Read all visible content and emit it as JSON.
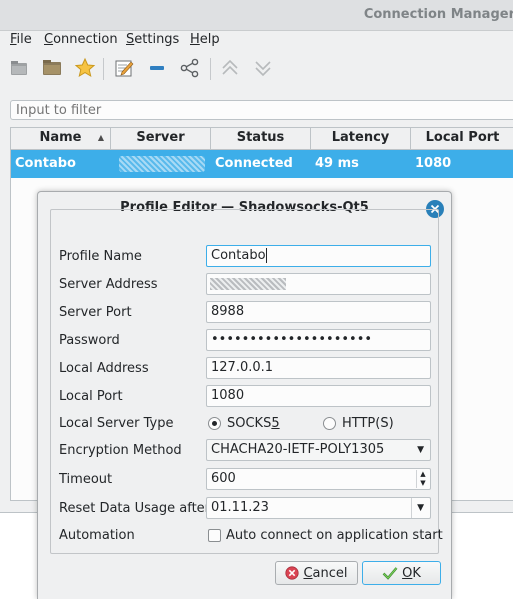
{
  "window": {
    "title": "Connection Manager"
  },
  "menu": {
    "file": {
      "lead": "F",
      "rest": "ile"
    },
    "connection": {
      "lead": "C",
      "rest": "onnection"
    },
    "settings": {
      "lead": "S",
      "rest": "ettings"
    },
    "help": {
      "lead": "H",
      "rest": "elp"
    }
  },
  "toolbar": {
    "icons": [
      "disconnect-icon",
      "folder-icon",
      "star-icon",
      "edit-icon",
      "remove-icon",
      "share-icon",
      "move-up-icon",
      "move-down-icon"
    ]
  },
  "filter": {
    "placeholder": "Input to filter"
  },
  "table": {
    "columns": [
      "Name",
      "Server",
      "Status",
      "Latency",
      "Local Port"
    ],
    "rows": [
      {
        "name": "Contabo",
        "server": "",
        "status": "Connected",
        "latency": "49 ms",
        "local_port": "1080"
      }
    ]
  },
  "dialog": {
    "title": "Profile Editor — Shadowsocks-Qt5",
    "labels": {
      "profile_name": "Profile Name",
      "server_address": "Server Address",
      "server_port": "Server Port",
      "password": "Password",
      "local_address": "Local Address",
      "local_port": "Local Port",
      "local_server_type": "Local Server Type",
      "encryption_method": "Encryption Method",
      "timeout": "Timeout",
      "reset_data": "Reset Data Usage after",
      "automation": "Automation"
    },
    "values": {
      "profile_name": "Contabo",
      "server_address": "",
      "server_port": "8988",
      "password": "•••••••••••••••••••••",
      "local_address": "127.0.0.1",
      "local_port": "1080",
      "encryption_method": "CHACHA20-IETF-POLY1305",
      "timeout": "600",
      "reset_date": "01.11.23"
    },
    "server_type": {
      "socks_lead": "SOCKS",
      "socks_tail": "5",
      "http": "HTTP(S)",
      "selected": "SOCKS5"
    },
    "automation_label": "Auto connect on application start",
    "automation_checked": false,
    "buttons": {
      "cancel_lead": "C",
      "cancel_rest": "ancel",
      "ok_lead": "O",
      "ok_rest": "K"
    }
  },
  "colors": {
    "selection": "#3daee9",
    "accent": "#2980b9",
    "cancel_icon": "#da4453"
  }
}
